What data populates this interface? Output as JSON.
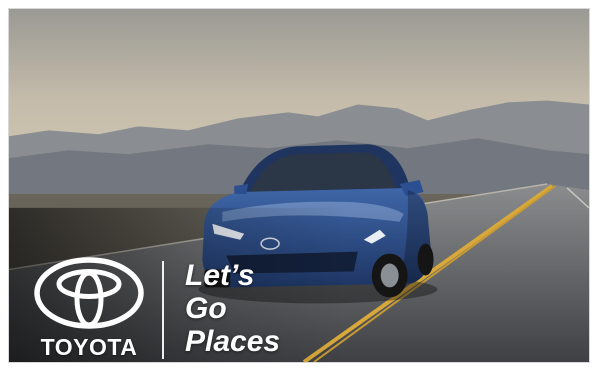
{
  "ad": {
    "brand_name": "TOYOTA",
    "tagline": [
      "Let’s",
      "Go",
      "Places"
    ],
    "logo_icon": "toyota-emblem-icon",
    "colors": {
      "sky": "#bdb5a6",
      "mountains": "#7a8088",
      "road": "#55585c",
      "lane_line": "#d8a83a",
      "car_body": "#2d4f8c",
      "text": "#ffffff"
    }
  }
}
